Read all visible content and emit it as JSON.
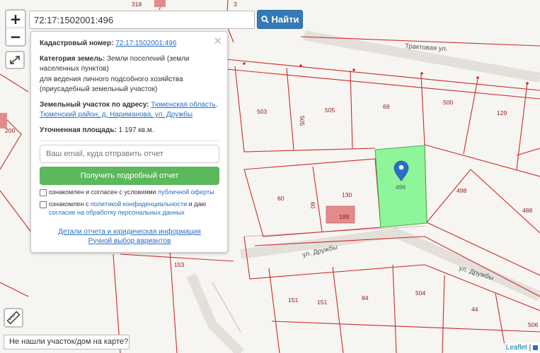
{
  "map": {
    "streets": [
      {
        "name": "Трактовая ул.",
        "id": "street-traktovaya"
      },
      {
        "name": "ул. Дружбы",
        "id": "street-druzhby-1"
      },
      {
        "name": "ул. Дружбы",
        "id": "street-druzhby-2"
      }
    ],
    "parcel_numbers": [
      "318",
      "3",
      "200",
      "503",
      "505",
      "505",
      "69",
      "500",
      "129",
      "496",
      "498",
      "488",
      "60",
      "130",
      "60",
      "189",
      "153",
      "151",
      "151",
      "84",
      "504",
      "44",
      "506"
    ],
    "selected_parcel": "496",
    "colors": {
      "parcel_line": "#cc2b2b",
      "selected_fill": "#8ef59a",
      "label": "#8b1a1a",
      "building": "#e38b8b",
      "marker": "#2a6ec5"
    }
  },
  "controls": {
    "zoom_in": "+",
    "zoom_out": "−",
    "search_value": "72:17:1502001:496",
    "search_button": "Найти",
    "not_found": "Не нашли участок/дом на карте?"
  },
  "popup": {
    "cadastral_label": "Кадастровый номер:",
    "cadastral_value": "72:17:1502001:496",
    "category_label": "Категория земель:",
    "category_value": "Земли поселений (земли населенных пунктов)",
    "purpose": "для ведения личного подсобного хозяйства (приусадебный земельный участок)",
    "address_label": "Земельный участок по адресу:",
    "address_value": "Тюменская область, Тюменский район, д. Нариманова, ул. Дружбы",
    "area_label": "Уточненная площадь:",
    "area_value": "1 197 кв.м.",
    "email_placeholder": "Ваш email, куда отправить отчет",
    "report_button": "Получить подробный отчет",
    "consent1_text": "ознакомлен и согласен с условиями",
    "consent1_link": "публичной оферты",
    "consent2_text": "ознакомлен с",
    "consent2_link1": "политикой конфиденциальности",
    "consent2_mid": "и даю",
    "consent2_link2": "согласие на обработку персональных данных",
    "link_details": "Детали отчета и юридическая информация",
    "link_manual": "Ручной выбор вариантов"
  },
  "attribution": {
    "leaflet": "Leaflet",
    "sep": "|"
  }
}
